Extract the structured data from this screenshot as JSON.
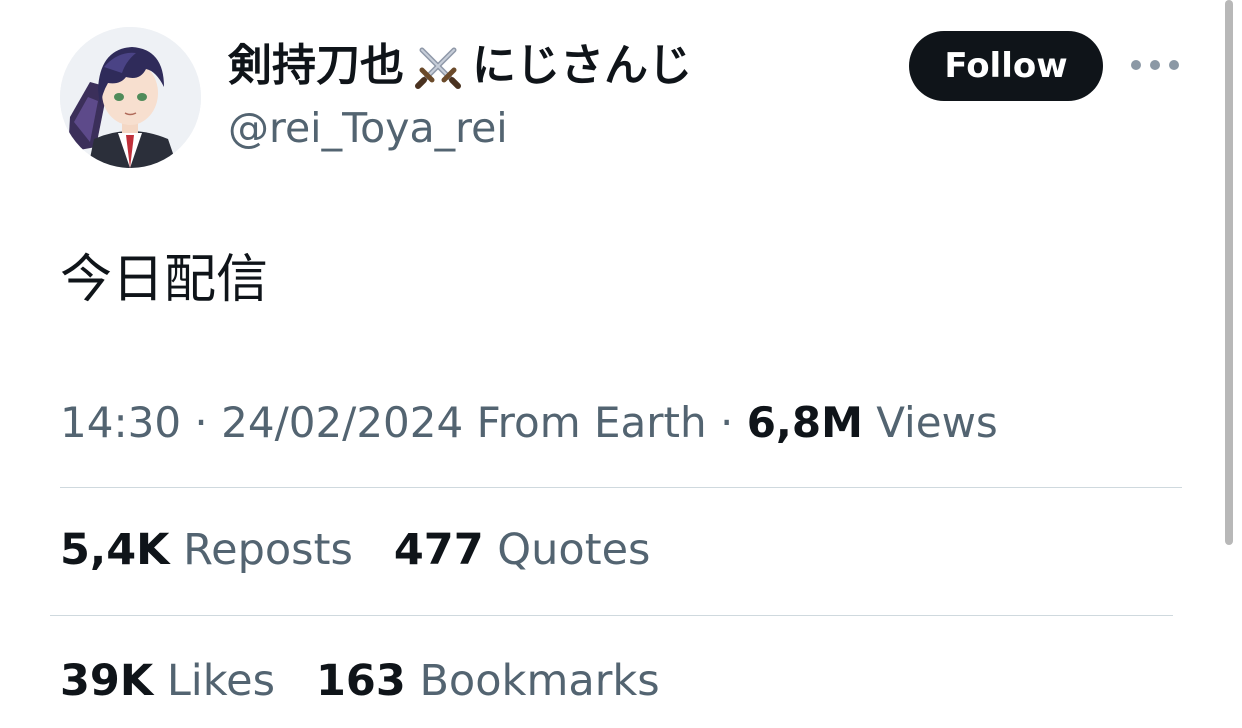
{
  "author": {
    "display_name_prefix": "剣持刀也",
    "display_name_suffix": "にじさんじ",
    "name_emoji_icon": "crossed-swords-icon",
    "handle": "@rei_Toya_rei",
    "avatar_icon": "anime-character-avatar"
  },
  "follow_button": {
    "label": "Follow"
  },
  "more_menu": {
    "icon": "more-horizontal-icon"
  },
  "tweet": {
    "text": "今日配信"
  },
  "meta": {
    "time": "14:30",
    "sep1": "·",
    "date": "24/02/2024",
    "source": "From Earth",
    "sep2": "·",
    "views_count": "6,8M",
    "views_label": "Views"
  },
  "stats": {
    "reposts_count": "5,4K",
    "reposts_label": "Reposts",
    "quotes_count": "477",
    "quotes_label": "Quotes",
    "likes_count": "39K",
    "likes_label": "Likes",
    "bookmarks_count": "163",
    "bookmarks_label": "Bookmarks"
  },
  "colors": {
    "primary_text": "#0f1419",
    "secondary_text": "#536471",
    "divider": "#cfd9de",
    "follow_bg": "#0f1419"
  }
}
